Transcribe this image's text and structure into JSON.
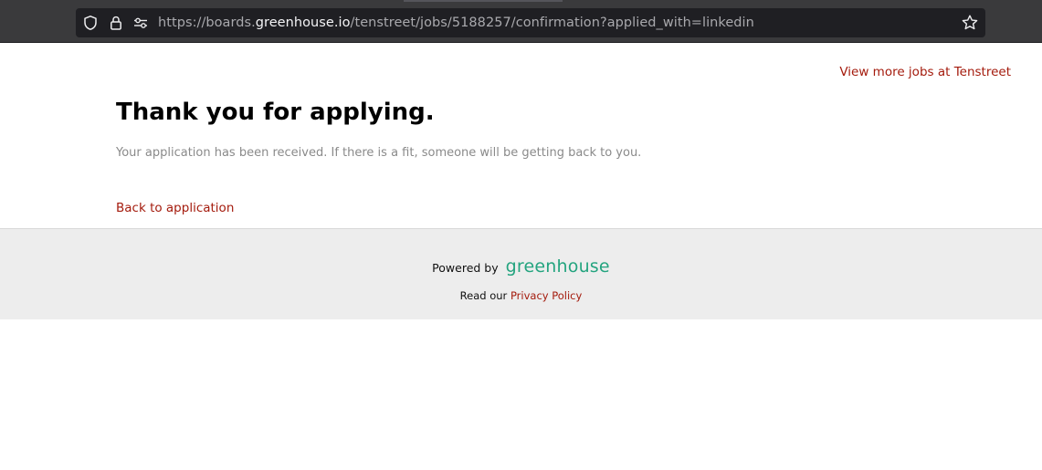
{
  "browser": {
    "url_prefix": "https://boards.",
    "url_host": "greenhouse.io",
    "url_path": "/tenstreet/jobs/5188257/confirmation?applied_with=linkedin",
    "icons": [
      "shield-icon",
      "lock-icon",
      "permissions-icon",
      "bookmark-star-icon"
    ]
  },
  "header": {
    "more_jobs_link": "View more jobs at Tenstreet"
  },
  "confirmation": {
    "heading": "Thank you for applying.",
    "message": "Your application has been received. If there is a fit, someone will be getting back to you.",
    "back_link": "Back to application"
  },
  "footer": {
    "powered_by": "Powered by",
    "logo_text": "greenhouse",
    "read_our": "Read our",
    "privacy_link": "Privacy Policy"
  },
  "colors": {
    "link": "#a41b0d",
    "logo": "#24a47f",
    "footer_bg": "#ededed",
    "chrome_bg": "#3a3a3c"
  }
}
